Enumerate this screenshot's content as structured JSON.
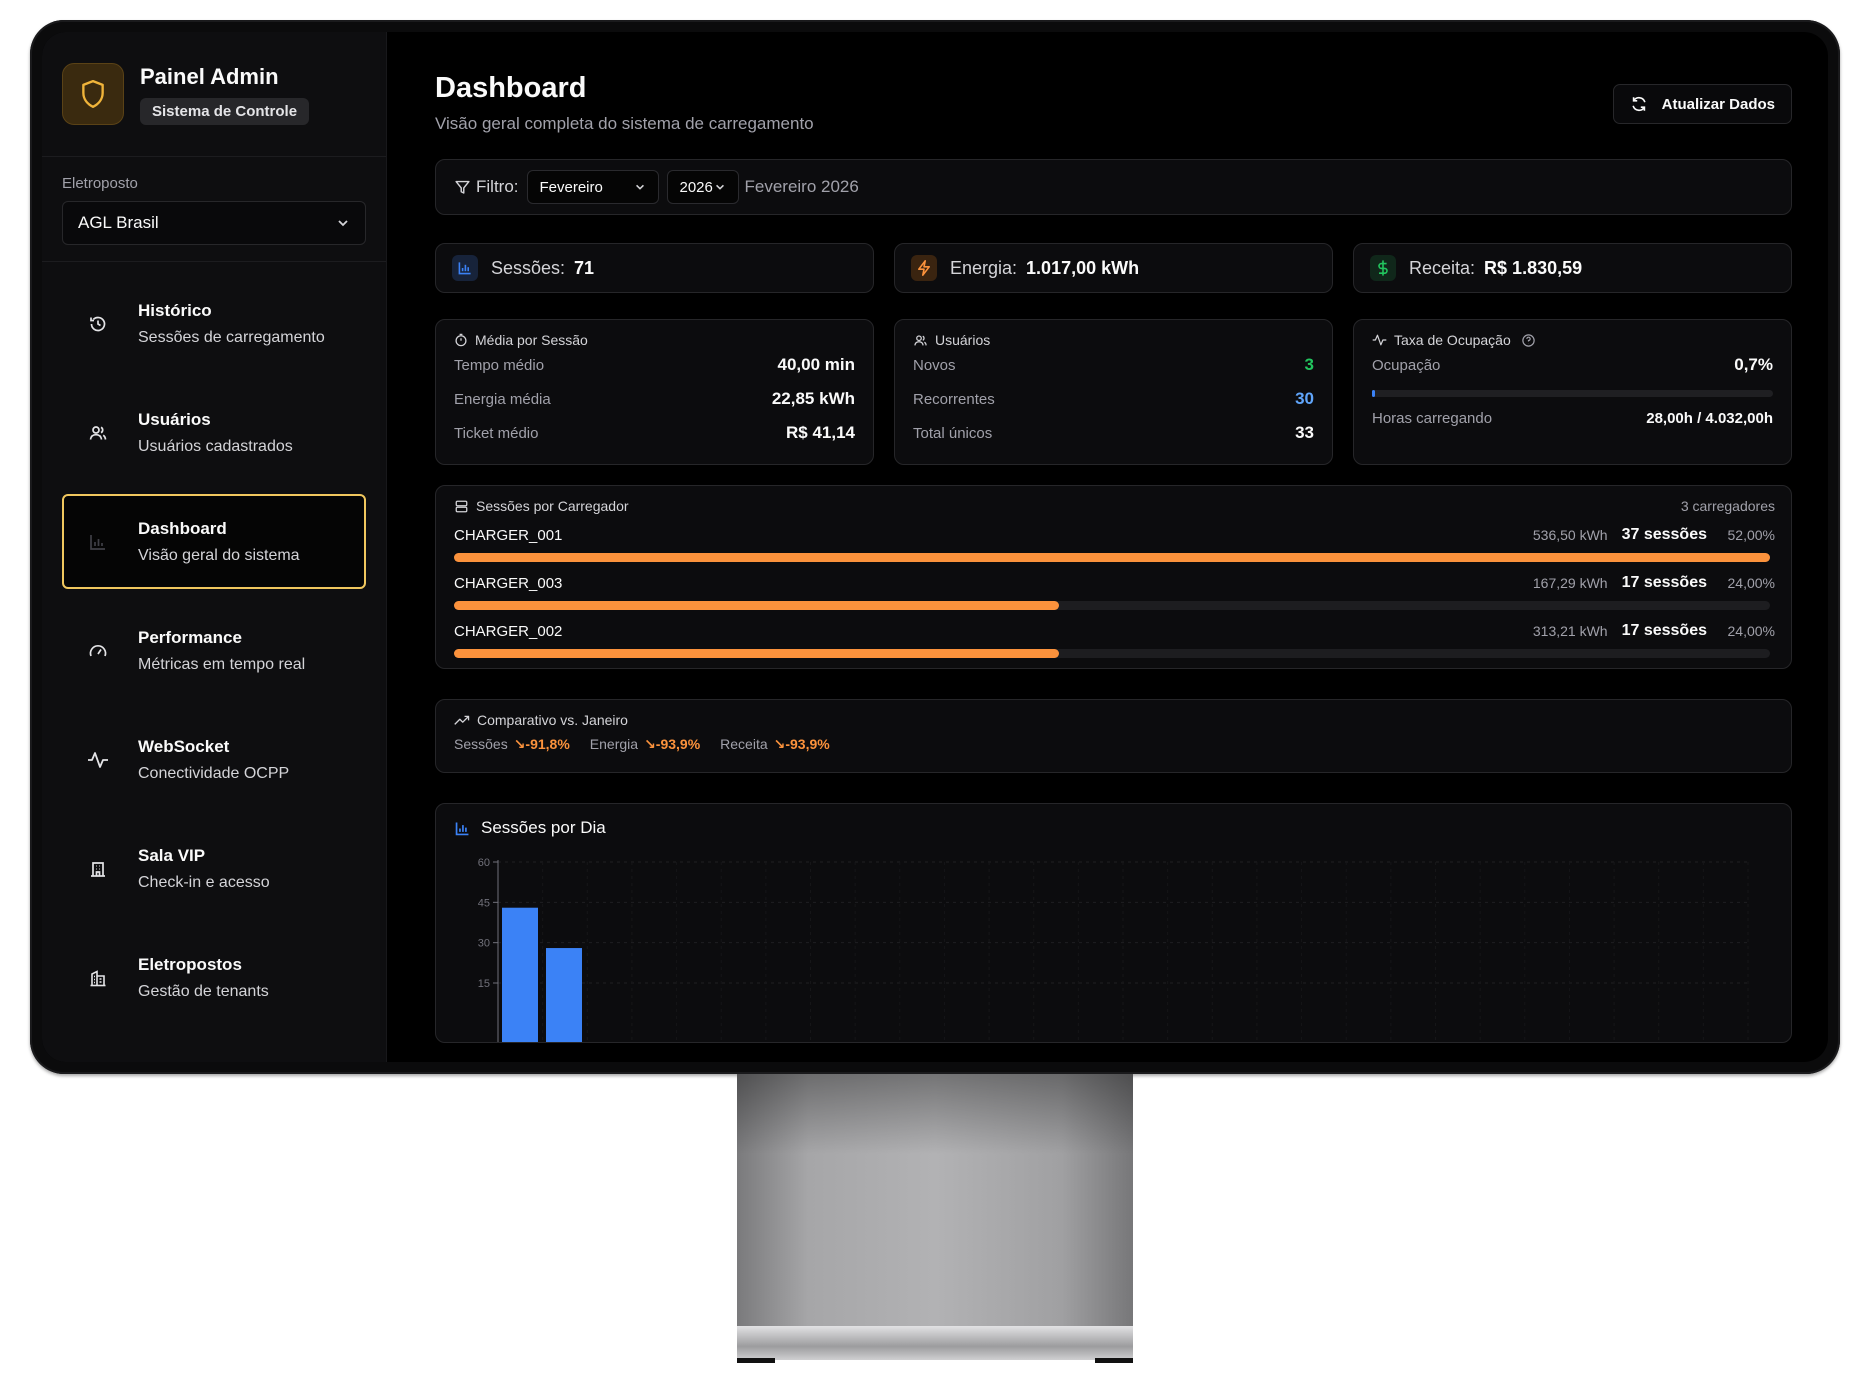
{
  "brand": {
    "title": "Painel Admin",
    "badge": "Sistema de Controle"
  },
  "station": {
    "label": "Eletroposto",
    "value": "AGL Brasil"
  },
  "nav": [
    {
      "title": "Histórico",
      "sub": "Sessões de carregamento",
      "icon": "history-icon"
    },
    {
      "title": "Usuários",
      "sub": "Usuários cadastrados",
      "icon": "users-icon"
    },
    {
      "title": "Dashboard",
      "sub": "Visão geral do sistema",
      "icon": "bar-chart-icon",
      "active": true
    },
    {
      "title": "Performance",
      "sub": "Métricas em tempo real",
      "icon": "gauge-icon"
    },
    {
      "title": "WebSocket",
      "sub": "Conectividade OCPP",
      "icon": "activity-icon"
    },
    {
      "title": "Sala VIP",
      "sub": "Check-in e acesso",
      "icon": "building-icon"
    },
    {
      "title": "Eletropostos",
      "sub": "Gestão de tenants",
      "icon": "buildings-icon"
    }
  ],
  "header": {
    "title": "Dashboard",
    "subtitle": "Visão geral completa do sistema de carregamento",
    "refresh": "Atualizar Dados"
  },
  "filter": {
    "label": "Filtro:",
    "month": "Fevereiro",
    "year": "2026",
    "current": "Fevereiro 2026"
  },
  "stats": [
    {
      "label": "Sessões:",
      "value": "71",
      "icon": "bar-chart-icon",
      "color": "#3b82f6"
    },
    {
      "label": "Energia:",
      "value": "1.017,00 kWh",
      "icon": "zap-icon",
      "color": "#fb923c"
    },
    {
      "label": "Receita:",
      "value": "R$ 1.830,59",
      "icon": "dollar-icon",
      "color": "#22c55e"
    }
  ],
  "media": {
    "title": "Média por Sessão",
    "rows": [
      {
        "k": "Tempo médio",
        "v": "40,00 min"
      },
      {
        "k": "Energia média",
        "v": "22,85 kWh"
      },
      {
        "k": "Ticket médio",
        "v": "R$ 41,14"
      }
    ]
  },
  "usuarios": {
    "title": "Usuários",
    "rows": [
      {
        "k": "Novos",
        "v": "3",
        "color": "#22c55e"
      },
      {
        "k": "Recorrentes",
        "v": "30",
        "color": "#60a5fa"
      },
      {
        "k": "Total únicos",
        "v": "33",
        "color": "#fafafa"
      }
    ]
  },
  "ocupacao": {
    "title": "Taxa de Ocupação",
    "occ_label": "Ocupação",
    "occ_value": "0,7%",
    "occ_fraction": 0.007,
    "hours_label": "Horas carregando",
    "hours_value": "28,00h / 4.032,00h"
  },
  "chargers": {
    "title": "Sessões por Carregador",
    "count": "3 carregadores",
    "items": [
      {
        "name": "CHARGER_001",
        "kwh": "536,50 kWh",
        "sessions": "37 sessões",
        "pct": "52,00%",
        "fraction": 1.0
      },
      {
        "name": "CHARGER_003",
        "kwh": "167,29 kWh",
        "sessions": "17 sessões",
        "pct": "24,00%",
        "fraction": 0.46
      },
      {
        "name": "CHARGER_002",
        "kwh": "313,21 kWh",
        "sessions": "17 sessões",
        "pct": "24,00%",
        "fraction": 0.46
      }
    ]
  },
  "compare": {
    "title": "Comparativo vs. Janeiro",
    "items": [
      {
        "k": "Sessões",
        "v": "↘-91,8%"
      },
      {
        "k": "Energia",
        "v": "↘-93,9%"
      },
      {
        "k": "Receita",
        "v": "↘-93,9%"
      }
    ]
  },
  "daily": {
    "title": "Sessões por Dia"
  },
  "chart_data": {
    "type": "bar",
    "title": "Sessões por Dia",
    "xlabel": "",
    "ylabel": "",
    "yticks": [
      15,
      30,
      45,
      60
    ],
    "ylim": [
      0,
      60
    ],
    "values": [
      43,
      28
    ],
    "color": "#3b82f6",
    "grid": true
  }
}
